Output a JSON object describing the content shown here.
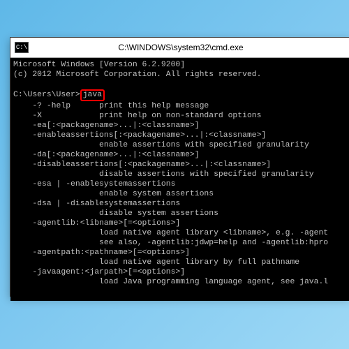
{
  "window": {
    "icon_text": "C:\\",
    "title": "C:\\WINDOWS\\system32\\cmd.exe"
  },
  "terminal": {
    "banner_line1": "Microsoft Windows [Version 6.2.9200]",
    "banner_line2": "(c) 2012 Microsoft Corporation. All rights reserved.",
    "prompt_prefix": "C:\\Users\\User>",
    "command": "java",
    "help_lines": [
      "    -? -help      print this help message",
      "    -X            print help on non-standard options",
      "    -ea[:<packagename>...|:<classname>]",
      "    -enableassertions[:<packagename>...|:<classname>]",
      "                  enable assertions with specified granularity",
      "    -da[:<packagename>...|:<classname>]",
      "    -disableassertions[:<packagename>...|:<classname>]",
      "                  disable assertions with specified granularity",
      "    -esa | -enablesystemassertions",
      "                  enable system assertions",
      "    -dsa | -disablesystemassertions",
      "                  disable system assertions",
      "    -agentlib:<libname>[=<options>]",
      "                  load native agent library <libname>, e.g. -agent",
      "                  see also, -agentlib:jdwp=help and -agentlib:hpro",
      "    -agentpath:<pathname>[=<options>]",
      "                  load native agent library by full pathname",
      "    -javaagent:<jarpath>[=<options>]",
      "                  load Java programming language agent, see java.l"
    ]
  }
}
